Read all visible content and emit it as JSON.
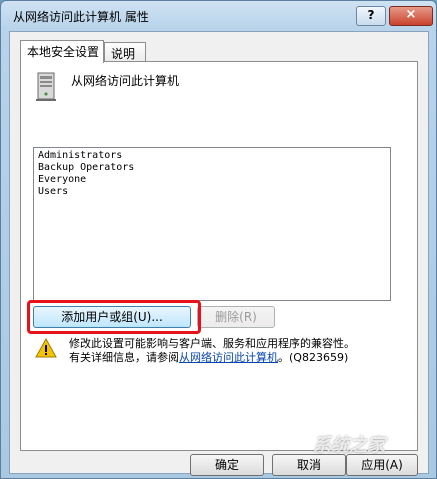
{
  "window": {
    "title": "从网络访问此计算机 属性",
    "help_label": "?",
    "close_label": "×"
  },
  "tabs": [
    {
      "label": "本地安全设置",
      "active": true
    },
    {
      "label": "说明",
      "active": false
    }
  ],
  "policy": {
    "name": "从网络访问此计算机",
    "icon": "computer-tower-icon"
  },
  "accounts": [
    "Administrators",
    "Backup Operators",
    "Everyone",
    "Users"
  ],
  "buttons": {
    "add": "添加用户或组(U)...",
    "remove": "删除(R)"
  },
  "warning": {
    "line1": "修改此设置可能影响与客户端、服务和应用程序的兼容性。",
    "line2_prefix": "有关详细信息，请参阅",
    "link": "从网络访问此计算机",
    "line2_suffix": "。(Q823659)",
    "icon": "warning-icon"
  },
  "footer": {
    "ok": "确定",
    "cancel": "取消",
    "apply": "应用(A)"
  },
  "watermark": "系统之家",
  "colors": {
    "highlight": "#e8121a",
    "link": "#0645ad"
  }
}
